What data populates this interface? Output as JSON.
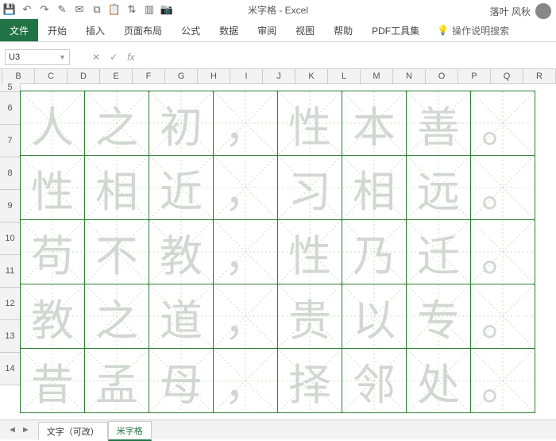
{
  "app": {
    "title": "米字格 - Excel",
    "user": "落叶 风秋"
  },
  "qat_icons": [
    "save",
    "undo",
    "redo",
    "brush",
    "mail",
    "copy",
    "paste",
    "sort",
    "chart",
    "camera"
  ],
  "ribbon": {
    "file": "文件",
    "tabs": [
      "开始",
      "插入",
      "页面布局",
      "公式",
      "数据",
      "审阅",
      "视图",
      "帮助",
      "PDF工具集"
    ],
    "tell_me": "操作说明搜索"
  },
  "namebox": "U3",
  "columns": [
    "B",
    "C",
    "D",
    "E",
    "F",
    "G",
    "H",
    "I",
    "J",
    "K",
    "L",
    "M",
    "N",
    "O",
    "P",
    "Q",
    "R"
  ],
  "rows": [
    "5",
    "6",
    "7",
    "8",
    "9",
    "10",
    "11",
    "12",
    "13",
    "14"
  ],
  "chart_data": {
    "type": "table",
    "description": "米字格书法练习格，每格含一汉字（浅灰描红）",
    "cells": [
      [
        "人",
        "之",
        "初",
        "，",
        "性",
        "本",
        "善",
        "。"
      ],
      [
        "性",
        "相",
        "近",
        "，",
        "习",
        "相",
        "远",
        "。"
      ],
      [
        "苟",
        "不",
        "教",
        "，",
        "性",
        "乃",
        "迁",
        "。"
      ],
      [
        "教",
        "之",
        "道",
        "，",
        "贵",
        "以",
        "专",
        "。"
      ],
      [
        "昔",
        "孟",
        "母",
        "，",
        "择",
        "邻",
        "处",
        "。"
      ]
    ]
  },
  "sheet_tabs": {
    "editable": "文字（可改）",
    "active": "米字格"
  }
}
